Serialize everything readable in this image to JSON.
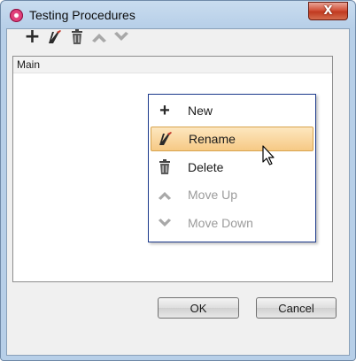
{
  "window": {
    "title": "Testing Procedures",
    "close_label": "X",
    "accent_color": "#d2533b"
  },
  "toolbar": {
    "buttons": [
      {
        "icon": "plus-icon",
        "enabled": true
      },
      {
        "icon": "rename-pen-icon",
        "enabled": true
      },
      {
        "icon": "trash-icon",
        "enabled": true
      },
      {
        "icon": "arrow-up-icon",
        "enabled": false
      },
      {
        "icon": "arrow-down-icon",
        "enabled": false
      }
    ]
  },
  "tree": {
    "root_label": "Main"
  },
  "context_menu": {
    "items": [
      {
        "label": "New",
        "icon": "plus-icon",
        "enabled": true,
        "selected": false
      },
      {
        "label": "Rename",
        "icon": "rename-pen-icon",
        "enabled": true,
        "selected": true
      },
      {
        "label": "Delete",
        "icon": "trash-icon",
        "enabled": true,
        "selected": false
      },
      {
        "label": "Move Up",
        "icon": "arrow-up-icon",
        "enabled": false,
        "selected": false
      },
      {
        "label": "Move Down",
        "icon": "arrow-down-icon",
        "enabled": false,
        "selected": false
      }
    ]
  },
  "footer": {
    "ok_label": "OK",
    "cancel_label": "Cancel"
  }
}
